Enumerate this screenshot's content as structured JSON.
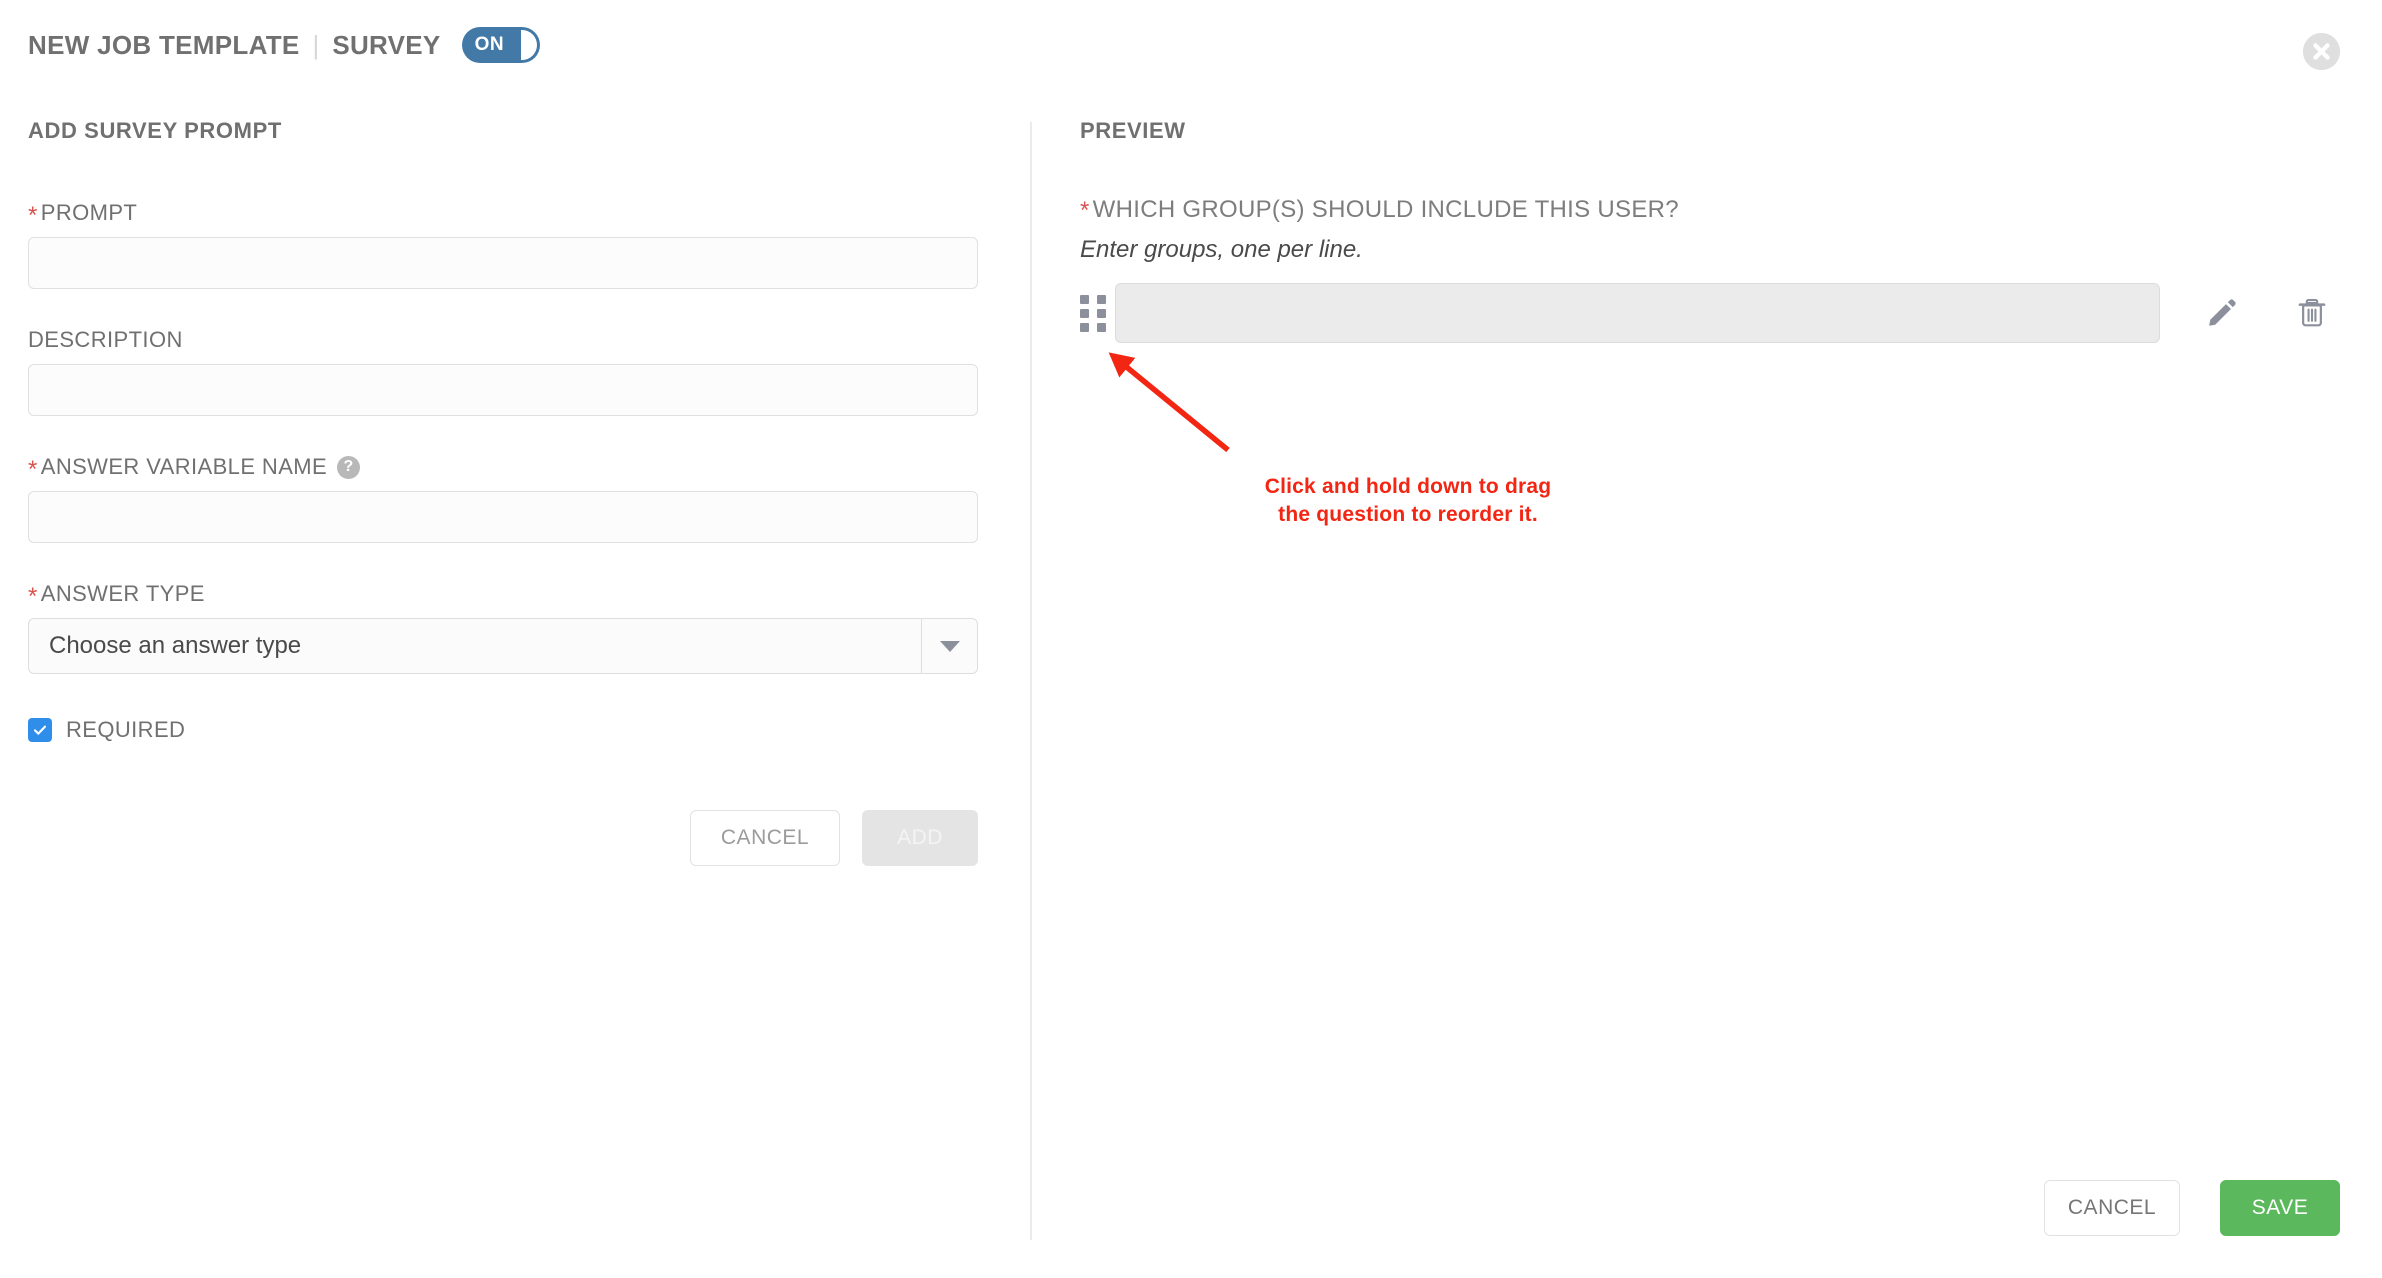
{
  "header": {
    "title": "NEW JOB TEMPLATE",
    "separator": "|",
    "subtitle": "SURVEY",
    "toggle_label": "ON",
    "toggle_state": "on",
    "close_icon": "close-circle-icon",
    "accent_color": "#4379a7"
  },
  "left": {
    "section_title": "ADD SURVEY PROMPT",
    "fields": [
      {
        "label": "PROMPT",
        "required": true,
        "required_marker": "*",
        "value": "",
        "placeholder": ""
      },
      {
        "label": "DESCRIPTION",
        "required": false,
        "required_marker": "",
        "value": "",
        "placeholder": ""
      },
      {
        "label": "ANSWER VARIABLE NAME",
        "required": true,
        "required_marker": "*",
        "value": "",
        "placeholder": "",
        "help_icon": "help-circle-icon"
      }
    ],
    "answer_type": {
      "label": "ANSWER TYPE",
      "required_marker": "*",
      "selected": "Choose an answer type",
      "caret_icon": "chevron-down-icon"
    },
    "required_checkbox": {
      "label": "REQUIRED",
      "checked": true,
      "color": "#2f8eea"
    },
    "actions": {
      "cancel_label": "CANCEL",
      "add_label": "ADD",
      "add_disabled": true
    }
  },
  "right": {
    "section_title": "PREVIEW",
    "question": {
      "required_marker": "*",
      "text": "WHICH GROUP(S) SHOULD INCLUDE THIS USER?",
      "hint": "Enter groups, one per line.",
      "answer_value": "",
      "drag_handle_icon": "drag-handle-icon",
      "edit_icon": "pencil-icon",
      "delete_icon": "trash-icon"
    }
  },
  "annotation": {
    "line1": "Click and hold down to drag",
    "line2": "the question to reorder it.",
    "color": "#f22613",
    "arrow_icon": "arrow-pointer-icon"
  },
  "footer": {
    "cancel_label": "CANCEL",
    "save_label": "SAVE",
    "save_color": "#5cb85c"
  }
}
